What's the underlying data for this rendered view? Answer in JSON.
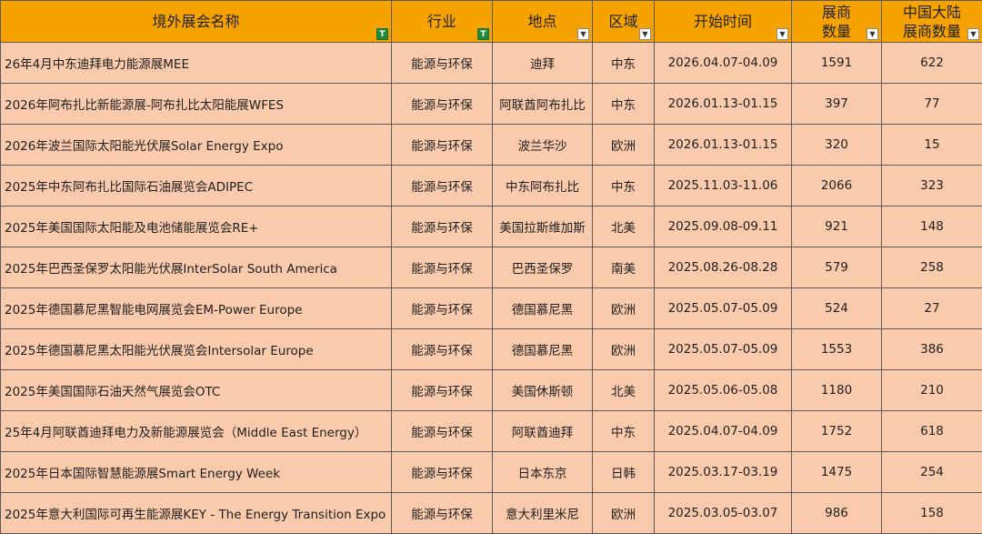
{
  "columns": [
    {
      "label": "境外展会名称",
      "filter_icon": "filter-active-icon"
    },
    {
      "label": "行业",
      "filter_icon": "filter-active-icon"
    },
    {
      "label": "地点",
      "filter_icon": "dropdown-arrow-icon"
    },
    {
      "label": "区域",
      "filter_icon": "dropdown-arrow-icon"
    },
    {
      "label": "开始时间",
      "filter_icon": "dropdown-arrow-icon"
    },
    {
      "label": "展商\n数量",
      "filter_icon": "dropdown-arrow-icon"
    },
    {
      "label": "中国大陆\n展商数量",
      "filter_icon": "dropdown-arrow-icon"
    }
  ],
  "rows": [
    {
      "name": "26年4月中东迪拜电力能源展MEE",
      "industry": "能源与环保",
      "location": "迪拜",
      "region": "中东",
      "date": "2026.04.07-04.09",
      "exhibitors": "1591",
      "china_exhibitors": "622"
    },
    {
      "name": "2026年阿布扎比新能源展-阿布扎比太阳能展WFES",
      "industry": "能源与环保",
      "location": "阿联酋阿布扎比",
      "region": "中东",
      "date": "2026.01.13-01.15",
      "exhibitors": "397",
      "china_exhibitors": "77"
    },
    {
      "name": "2026年波兰国际太阳能光伏展Solar Energy Expo",
      "industry": "能源与环保",
      "location": "波兰华沙",
      "region": "欧洲",
      "date": "2026.01.13-01.15",
      "exhibitors": "320",
      "china_exhibitors": "15"
    },
    {
      "name": "2025年中东阿布扎比国际石油展览会ADIPEC",
      "industry": "能源与环保",
      "location": "中东阿布扎比",
      "region": "中东",
      "date": "2025.11.03-11.06",
      "exhibitors": "2066",
      "china_exhibitors": "323"
    },
    {
      "name": "2025年美国国际太阳能及电池储能展览会RE+",
      "industry": "能源与环保",
      "location": "美国拉斯维加斯",
      "region": "北美",
      "date": "2025.09.08-09.11",
      "exhibitors": "921",
      "china_exhibitors": "148"
    },
    {
      "name": "2025年巴西圣保罗太阳能光伏展InterSolar South America",
      "industry": "能源与环保",
      "location": "巴西圣保罗",
      "region": "南美",
      "date": "2025.08.26-08.28",
      "exhibitors": "579",
      "china_exhibitors": "258"
    },
    {
      "name": "2025年德国慕尼黑智能电网展览会EM-Power Europe",
      "industry": "能源与环保",
      "location": "德国慕尼黑",
      "region": "欧洲",
      "date": "2025.05.07-05.09",
      "exhibitors": "524",
      "china_exhibitors": "27"
    },
    {
      "name": "2025年德国慕尼黑太阳能光伏展览会Intersolar Europe",
      "industry": "能源与环保",
      "location": "德国慕尼黑",
      "region": "欧洲",
      "date": "2025.05.07-05.09",
      "exhibitors": "1553",
      "china_exhibitors": "386"
    },
    {
      "name": "2025年美国国际石油天然气展览会OTC",
      "industry": "能源与环保",
      "location": "美国休斯顿",
      "region": "北美",
      "date": "2025.05.06-05.08",
      "exhibitors": "1180",
      "china_exhibitors": "210"
    },
    {
      "name": "25年4月阿联酋迪拜电力及新能源展览会（Middle East Energy）",
      "industry": "能源与环保",
      "location": "阿联酋迪拜",
      "region": "中东",
      "date": "2025.04.07-04.09",
      "exhibitors": "1752",
      "china_exhibitors": "618"
    },
    {
      "name": "2025年日本国际智慧能源展Smart Energy Week",
      "industry": "能源与环保",
      "location": "日本东京",
      "region": "日韩",
      "date": "2025.03.17-03.19",
      "exhibitors": "1475",
      "china_exhibitors": "254"
    },
    {
      "name": "2025年意大利国际可再生能源展KEY - The Energy Transition Expo",
      "industry": "能源与环保",
      "location": "意大利里米尼",
      "region": "欧洲",
      "date": "2025.03.05-03.07",
      "exhibitors": "986",
      "china_exhibitors": "158"
    }
  ],
  "colors": {
    "header": "#f6a200",
    "row": "#f9cbac",
    "grid": "#5a5a5a",
    "active_filter": "#1f8a3a"
  }
}
